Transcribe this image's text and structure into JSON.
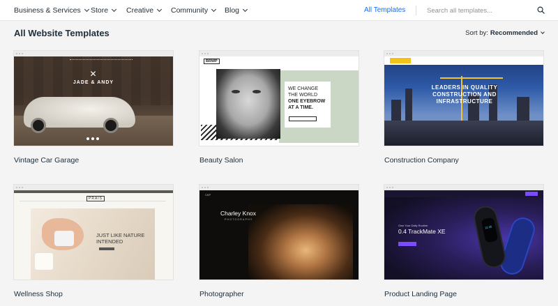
{
  "nav": {
    "items": [
      {
        "label": "Business & Services"
      },
      {
        "label": "Store"
      },
      {
        "label": "Creative"
      },
      {
        "label": "Community"
      },
      {
        "label": "Blog"
      }
    ],
    "all_templates": "All Templates",
    "search_placeholder": "Search all templates..."
  },
  "page_title": "All Website Templates",
  "sort": {
    "label": "Sort by:",
    "value": "Recommended"
  },
  "templates": [
    {
      "name": "Vintage Car Garage",
      "preview_text": {
        "logo": "JADE & ANDY"
      }
    },
    {
      "name": "Beauty Salon",
      "preview_text": {
        "brand": "BRWP",
        "line1": "WE CHANGE",
        "line2": "THE WORLD",
        "line3": "ONE EYEBROW",
        "line4": "AT A TIME."
      }
    },
    {
      "name": "Construction Company",
      "preview_text": {
        "headline": "LEADERS IN QUALITY CONSTRUCTION AND INFRASTRUCTURE"
      }
    },
    {
      "name": "Wellness Shop",
      "preview_text": {
        "logo": "PRAIS",
        "line1": "JUST LIKE NATURE",
        "line2": "INTENDED"
      }
    },
    {
      "name": "Photographer",
      "preview_text": {
        "name": "Charley Knox",
        "sub": "PHOTOGRAPHY"
      }
    },
    {
      "name": "Product Landing Page",
      "preview_text": {
        "kicker": "Own Your Daily Routine",
        "headline": "0.4 TrackMate XE"
      }
    }
  ],
  "colors": {
    "accent": "#116dff",
    "text": "#20303c",
    "background": "#f4f4f4"
  }
}
